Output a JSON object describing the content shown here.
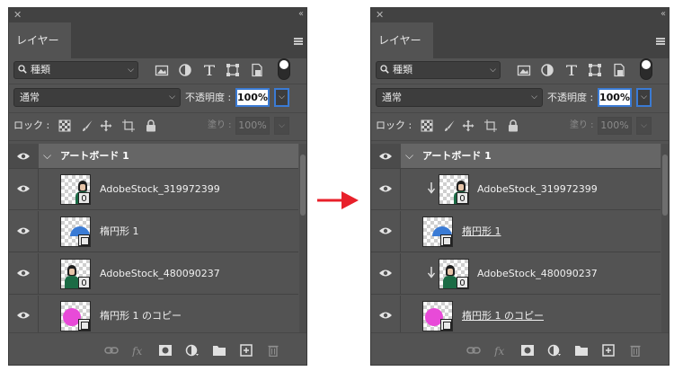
{
  "panels": [
    {
      "tab_label": "レイヤー",
      "filter": {
        "label": "種類"
      },
      "blend_mode": "通常",
      "opacity_label": "不透明度 :",
      "opacity_value": "100%",
      "lock_label": "ロック :",
      "fill_label": "塗り :",
      "fill_value": "100%",
      "artboard": {
        "name": "アートボード 1"
      },
      "layers": [
        {
          "name": "AdobeStock_319972399",
          "thumb": "person",
          "clipped": false,
          "underline": false
        },
        {
          "name": "楕円形 1",
          "thumb": "half-circle",
          "clipped": false,
          "underline": false
        },
        {
          "name": "AdobeStock_480090237",
          "thumb": "person",
          "clipped": false,
          "underline": false
        },
        {
          "name": "楕円形 1 のコピー",
          "thumb": "pink-circle",
          "clipped": false,
          "underline": false
        }
      ]
    },
    {
      "tab_label": "レイヤー",
      "filter": {
        "label": "種類"
      },
      "blend_mode": "通常",
      "opacity_label": "不透明度 :",
      "opacity_value": "100%",
      "lock_label": "ロック :",
      "fill_label": "塗り :",
      "fill_value": "100%",
      "artboard": {
        "name": "アートボード 1"
      },
      "layers": [
        {
          "name": "AdobeStock_319972399",
          "thumb": "person",
          "clipped": true,
          "underline": false
        },
        {
          "name": "楕円形 1",
          "thumb": "half-circle",
          "clipped": false,
          "underline": true
        },
        {
          "name": "AdobeStock_480090237",
          "thumb": "person",
          "clipped": true,
          "underline": false
        },
        {
          "name": "楕円形 1 のコピー",
          "thumb": "pink-circle",
          "clipped": false,
          "underline": true
        }
      ]
    }
  ],
  "colors": {
    "arrow": "#e8202a",
    "highlight": "#3b7bd4",
    "panel_bg": "#535353"
  },
  "icons": {
    "filter_icons": [
      "image-filter-icon",
      "adjustment-filter-icon",
      "text-filter-icon",
      "shape-filter-icon",
      "smart-object-filter-icon"
    ],
    "lock_icons": [
      "lock-transparent-pixels-icon",
      "lock-image-pixels-icon",
      "lock-position-icon",
      "lock-artboard-icon",
      "lock-all-icon"
    ],
    "footer_icons": [
      "link-layers-icon",
      "fx-icon",
      "add-mask-icon",
      "adjustment-layer-icon",
      "new-group-icon",
      "new-layer-icon",
      "delete-layer-icon"
    ]
  }
}
